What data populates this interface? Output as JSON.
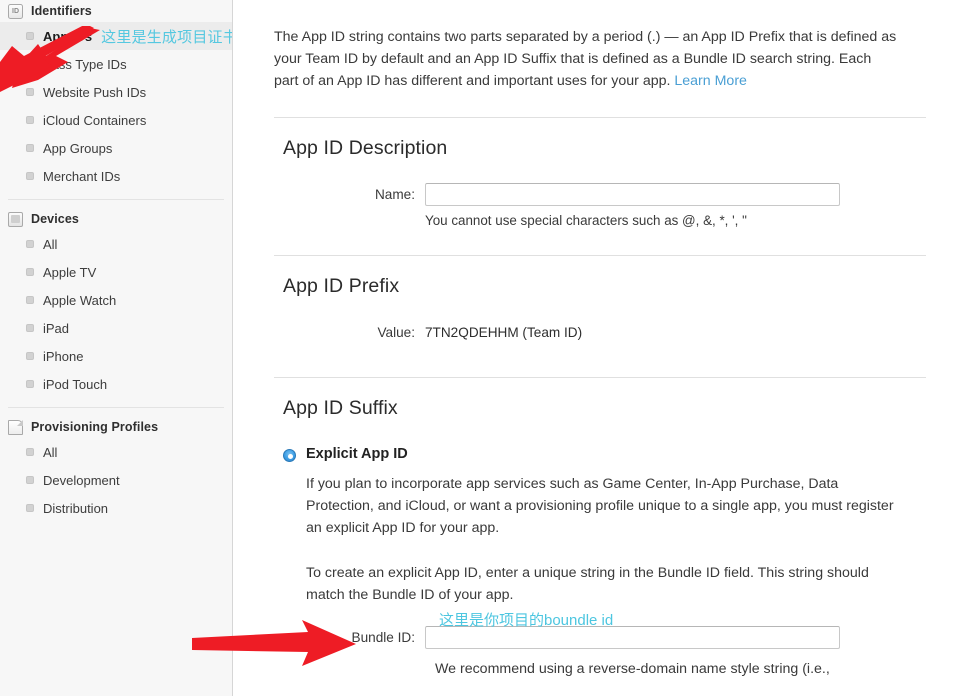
{
  "sidebar": {
    "groups": [
      {
        "title": "Identifiers",
        "icon": "id-badge-icon",
        "items": [
          {
            "label": "App IDs",
            "selected": true,
            "annotation": "这里是生成项目证书"
          },
          {
            "label": "Pass Type IDs",
            "selected": false
          },
          {
            "label": "Website Push IDs",
            "selected": false
          },
          {
            "label": "iCloud Containers",
            "selected": false
          },
          {
            "label": "App Groups",
            "selected": false
          },
          {
            "label": "Merchant IDs",
            "selected": false
          }
        ]
      },
      {
        "title": "Devices",
        "icon": "device-icon",
        "items": [
          {
            "label": "All",
            "selected": false
          },
          {
            "label": "Apple TV",
            "selected": false
          },
          {
            "label": "Apple Watch",
            "selected": false
          },
          {
            "label": "iPad",
            "selected": false
          },
          {
            "label": "iPhone",
            "selected": false
          },
          {
            "label": "iPod Touch",
            "selected": false
          }
        ]
      },
      {
        "title": "Provisioning Profiles",
        "icon": "document-icon",
        "items": [
          {
            "label": "All",
            "selected": false
          },
          {
            "label": "Development",
            "selected": false
          },
          {
            "label": "Distribution",
            "selected": false
          }
        ]
      }
    ]
  },
  "main": {
    "intro": {
      "text": "The App ID string contains two parts separated by a period (.) — an App ID Prefix that is defined as your Team ID by default and an App ID Suffix that is defined as a Bundle ID search string. Each part of an App ID has different and important uses for your app. ",
      "link_label": "Learn More"
    },
    "description_section": {
      "title": "App ID Description",
      "name_label": "Name:",
      "name_value": "",
      "name_placeholder": "",
      "hint": "You cannot use special characters such as @, &, *, ', \""
    },
    "prefix_section": {
      "title": "App ID Prefix",
      "value_label": "Value:",
      "value": "7TN2QDEHHM (Team ID)"
    },
    "suffix_section": {
      "title": "App ID Suffix",
      "explicit": {
        "title": "Explicit App ID",
        "selected": true,
        "paragraph_1": "If you plan to incorporate app services such as Game Center, In-App Purchase, Data Protection, and iCloud, or want a provisioning profile unique to a single app, you must register an explicit App ID for your app.",
        "paragraph_2": "To create an explicit App ID, enter a unique string in the Bundle ID field. This string should match the Bundle ID of your app.",
        "bundle_label": "Bundle ID:",
        "bundle_value": "",
        "bundle_annotation": "这里是你项目的boundle id",
        "tail_text": "We recommend using a reverse-domain name style string (i.e.,"
      }
    }
  },
  "annotations": {
    "arrow_color": "#ee1c25",
    "callout_color": "#4dc6e0",
    "arrow_appids_name": "red-arrow-pointing-to-app-ids",
    "arrow_bundle_name": "red-arrow-pointing-to-bundle-id"
  }
}
